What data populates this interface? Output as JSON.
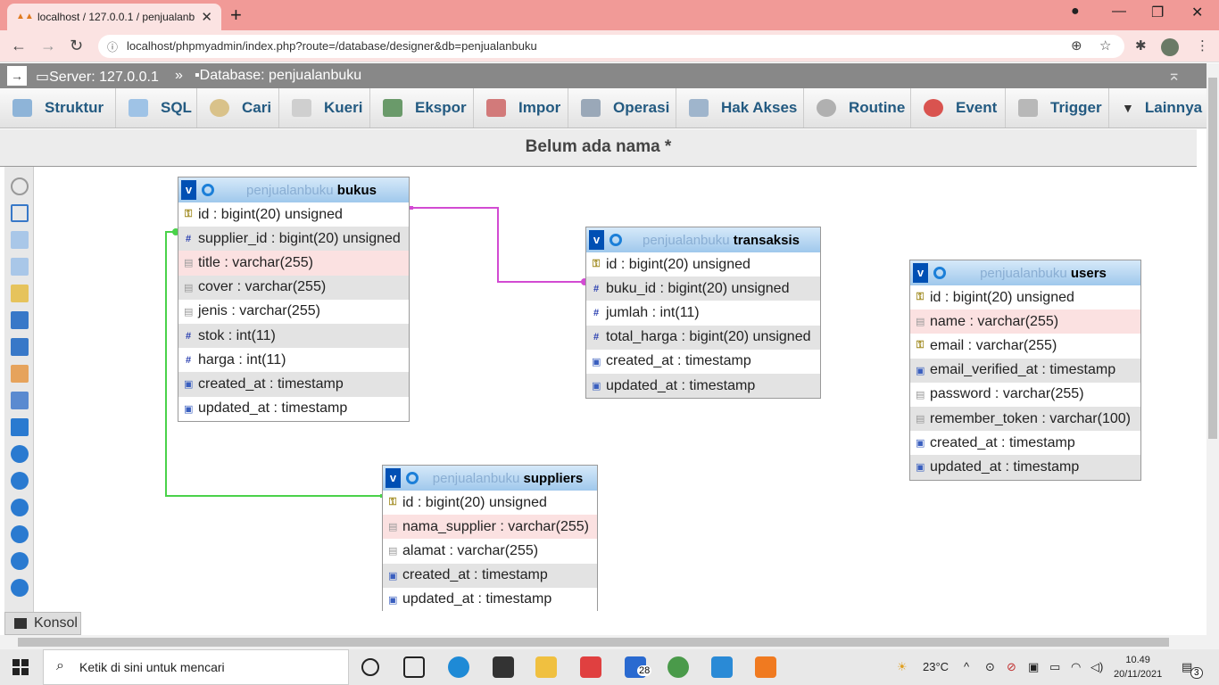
{
  "browser": {
    "tab_title": "localhost / 127.0.0.1 / penjualanb",
    "url": "localhost/phpmyadmin/index.php?route=/database/designer&db=penjualanbuku"
  },
  "pma": {
    "server": "Server: 127.0.0.1",
    "separator": "»",
    "database": "Database: penjualanbuku",
    "menu": [
      "Struktur",
      "SQL",
      "Cari",
      "Kueri",
      "Ekspor",
      "Impor",
      "Operasi",
      "Hak Akses",
      "Routine",
      "Event",
      "Trigger",
      "Lainnya"
    ],
    "designer_title": "Belum ada nama *",
    "console_label": "Konsol"
  },
  "tables": {
    "bukus": {
      "db": "penjualanbuku",
      "name": "bukus",
      "columns": [
        {
          "icon": "key",
          "text": "id : bigint(20) unsigned"
        },
        {
          "icon": "num",
          "text": "supplier_id : bigint(20) unsigned"
        },
        {
          "icon": "str",
          "text": "title : varchar(255)"
        },
        {
          "icon": "str",
          "text": "cover : varchar(255)"
        },
        {
          "icon": "str",
          "text": "jenis : varchar(255)"
        },
        {
          "icon": "num",
          "text": "stok : int(11)"
        },
        {
          "icon": "num",
          "text": "harga : int(11)"
        },
        {
          "icon": "date",
          "text": "created_at : timestamp"
        },
        {
          "icon": "date",
          "text": "updated_at : timestamp"
        }
      ]
    },
    "transaksis": {
      "db": "penjualanbuku",
      "name": "transaksis",
      "columns": [
        {
          "icon": "key",
          "text": "id : bigint(20) unsigned"
        },
        {
          "icon": "num",
          "text": "buku_id : bigint(20) unsigned"
        },
        {
          "icon": "num",
          "text": "jumlah : int(11)"
        },
        {
          "icon": "num",
          "text": "total_harga : bigint(20) unsigned"
        },
        {
          "icon": "date",
          "text": "created_at : timestamp"
        },
        {
          "icon": "date",
          "text": "updated_at : timestamp"
        }
      ]
    },
    "users": {
      "db": "penjualanbuku",
      "name": "users",
      "columns": [
        {
          "icon": "key",
          "text": "id : bigint(20) unsigned"
        },
        {
          "icon": "str",
          "text": "name : varchar(255)"
        },
        {
          "icon": "key",
          "text": "email : varchar(255)"
        },
        {
          "icon": "date",
          "text": "email_verified_at : timestamp"
        },
        {
          "icon": "str",
          "text": "password : varchar(255)"
        },
        {
          "icon": "str",
          "text": "remember_token : varchar(100)"
        },
        {
          "icon": "date",
          "text": "created_at : timestamp"
        },
        {
          "icon": "date",
          "text": "updated_at : timestamp"
        }
      ]
    },
    "suppliers": {
      "db": "penjualanbuku",
      "name": "suppliers",
      "columns": [
        {
          "icon": "key",
          "text": "id : bigint(20) unsigned"
        },
        {
          "icon": "str",
          "text": "nama_supplier : varchar(255)"
        },
        {
          "icon": "str",
          "text": "alamat : varchar(255)"
        },
        {
          "icon": "date",
          "text": "created_at : timestamp"
        },
        {
          "icon": "date",
          "text": "updated_at : timestamp"
        }
      ]
    }
  },
  "colors": {
    "relation_bukus_transaksis": "#d24bd2",
    "relation_suppliers_bukus": "#4ad24a"
  },
  "taskbar": {
    "search_placeholder": "Ketik di sini untuk mencari",
    "mail_badge": "28",
    "temperature": "23°C",
    "time": "10.49",
    "date": "20/11/2021",
    "notifications": "3"
  }
}
